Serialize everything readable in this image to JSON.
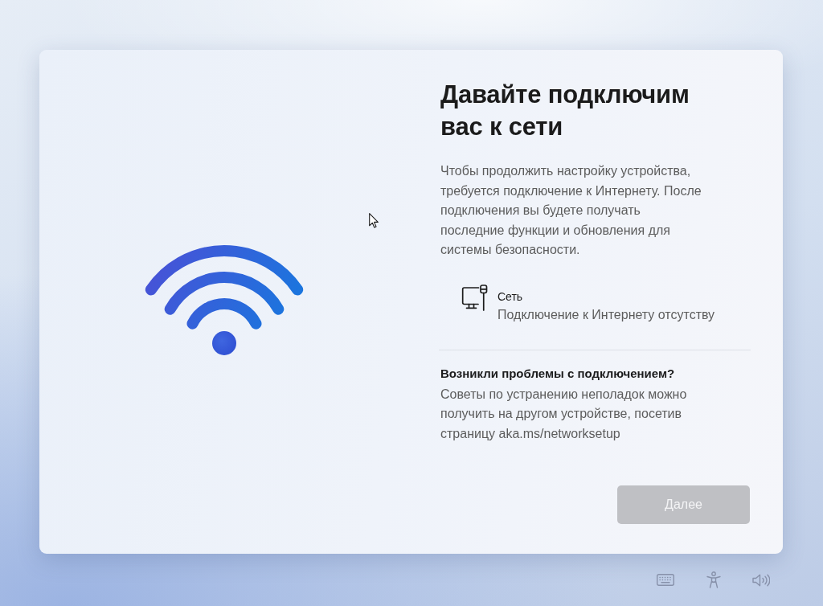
{
  "setup": {
    "title": "Давайте подключим\nвас к сети",
    "description": "Чтобы продолжить настройку устройства,\nтребуется подключение к Интернету. После\nподключения вы будете получать\nпоследние функции и обновления для\nсистемы безопасности.",
    "network": {
      "name": "Сеть",
      "status": "Подключение к Интернету отсутству"
    },
    "help": {
      "heading": "Возникли проблемы с подключением?",
      "text": "Советы по устранению неполадок можно\nполучить на другом устройстве, посетив\nстраницу aka.ms/networksetup"
    },
    "next_button": {
      "label": "Далее",
      "disabled": true
    }
  }
}
